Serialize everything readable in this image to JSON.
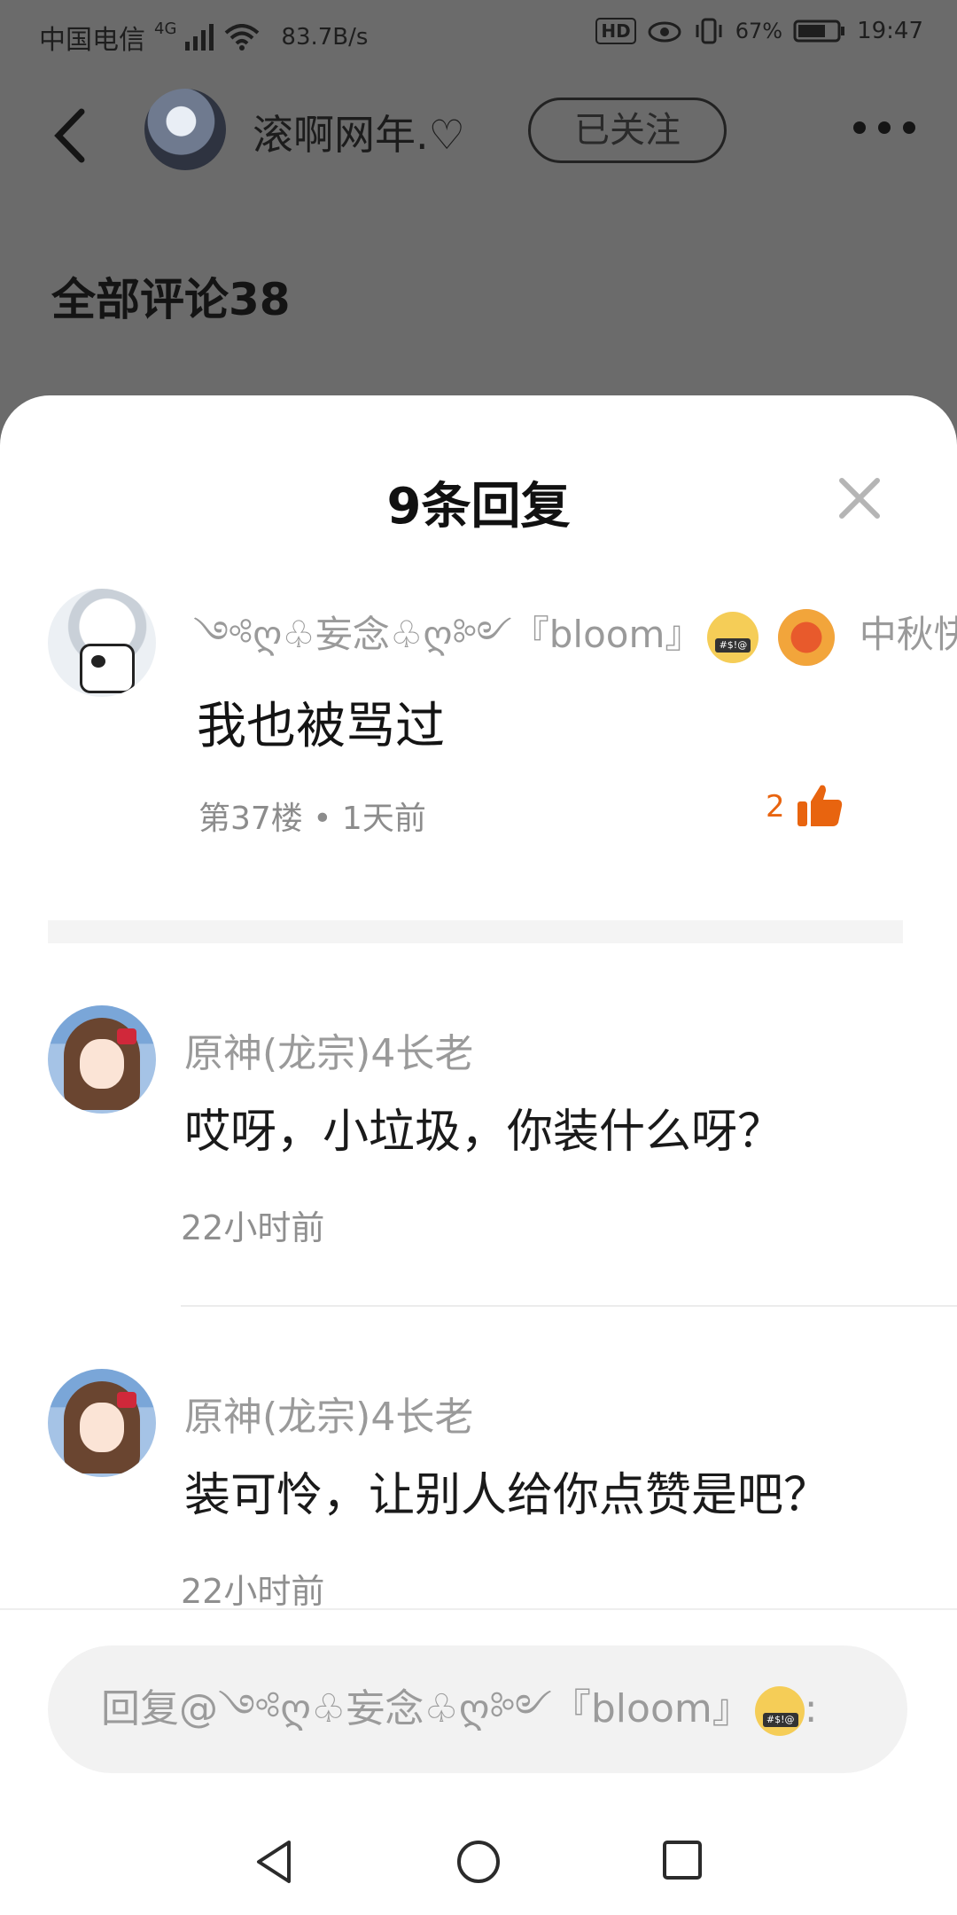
{
  "status_bar": {
    "carrier": "中国电信",
    "network": "4G",
    "speed": "83.7B/s",
    "hd": "HD",
    "battery": "67%",
    "time": "19:47"
  },
  "header": {
    "username": "滚啊网年.♡",
    "follow_label": "已关注",
    "all_comments_label": "全部评论38"
  },
  "sheet": {
    "title": "9条回复"
  },
  "main_comment": {
    "username": "༺ღ♧妄念♧ღ༻『bloom』",
    "event_badge": "中秋快乐",
    "text": "我也被骂过",
    "meta": "第37楼 • 1天前",
    "likes": "2"
  },
  "replies": [
    {
      "username": "原神(龙宗)4长老",
      "text": "哎呀，小垃圾，你装什么呀？",
      "time": "22小时前"
    },
    {
      "username": "原神(龙宗)4长老",
      "text": "装可怜，让别人给你点赞是吧？",
      "time": "22小时前"
    }
  ],
  "reply_box": {
    "placeholder": "回复@༺ღ♧妄念♧ღ༻『bloom』",
    "suffix": ":"
  },
  "icons": {
    "back": "chevron-left-icon",
    "more": "more-dots-icon",
    "close": "close-icon",
    "like": "thumbs-up-icon"
  },
  "colors": {
    "accent": "#e8640f",
    "overlay": "#6b6b6b"
  }
}
